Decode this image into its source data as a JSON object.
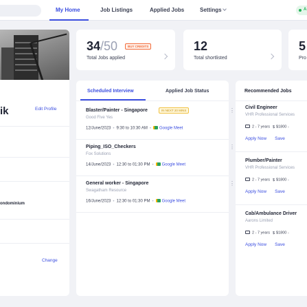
{
  "nav": {
    "items": [
      {
        "label": "My Home",
        "active": true
      },
      {
        "label": "Job Listings",
        "active": false
      },
      {
        "label": "Applied Jobs",
        "active": false
      },
      {
        "label": "Settings",
        "active": false
      }
    ],
    "status_label": "A"
  },
  "profile": {
    "name": "ik",
    "edit_label": "Edit Profile",
    "detail": "ondominium",
    "change_label": "Change"
  },
  "stats": [
    {
      "value": "34",
      "total": "/50",
      "badge": "BUY CREDITS",
      "label": "Total Jobs applied"
    },
    {
      "value": "12",
      "label": "Total shortlisted"
    },
    {
      "value": "5",
      "label": "Pro"
    }
  ],
  "interviews": {
    "tabs": [
      "Scheduled Interview",
      "Applied Job Status"
    ],
    "items": [
      {
        "title": "Blaster/Painter - Singapore",
        "badge": "IN NEXT 20 MINS",
        "company": "Good Five Yes",
        "date": "12/June/2023",
        "time": "9:30 to 10:30 AM",
        "meet": "Google Meet"
      },
      {
        "title": "Piping_ISO_Checkers",
        "company": "Fox Solutions",
        "date": "14/June/2023",
        "time": "12:30 to 01:30 PM",
        "meet": "Google Meet"
      },
      {
        "title": "General worker - Singapore",
        "company": "Swagatham Resource",
        "date": "16/June/2023",
        "time": "12:30 to 01:30 PM",
        "meet": "Google Meet"
      }
    ]
  },
  "recommended": {
    "header": "Recommended Jobs",
    "items": [
      {
        "title": "Civil Engineer",
        "company": "VHR Professional Services",
        "experience": "2 - 7 years",
        "salary": "$1800 -"
      },
      {
        "title": "Plumber/Painter",
        "company": "VHR Professional Services",
        "experience": "2 - 7 years",
        "salary": "$1800 -"
      },
      {
        "title": "Cab/Ambulance Driver",
        "company": "Aarons Limited",
        "experience": "2 - 7 years",
        "salary": "$1800 -"
      }
    ],
    "apply_label": "Apply Now",
    "save_label": "Save"
  },
  "colors": {
    "accent": "#3b4ee0",
    "badge_orange": "#f26b3a",
    "badge_yellow": "#f0c243",
    "status_green": "#25b35a"
  }
}
